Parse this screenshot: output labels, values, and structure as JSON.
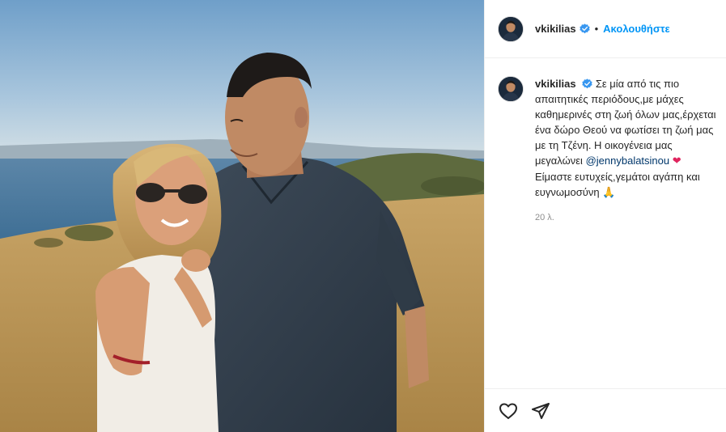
{
  "post": {
    "username": "vkikilias",
    "follow_label": "Ακολουθήστε",
    "separator": "•",
    "caption": {
      "username": "vkikilias",
      "text_part1": "Σε μία από τις πιο απαιτητικές περιόδους,με μάχες καθημερινές στη ζωή όλων μας,έρχεται ένα δώρο Θεού να φωτίσει τη ζωή μας με τη Τζένη. Η οικογένεια μας μεγαλώνει",
      "mention": "@jennybalatsinou",
      "heart_emoji": "❤",
      "text_part2": "Είμαστε ευτυχείς,γεμάτοι αγάπη και ευγνωμοσύνη",
      "pray_emoji": "🙏",
      "time": "20 λ."
    },
    "icons": {
      "verified": "verified-badge-icon",
      "like": "heart-icon",
      "share": "paper-plane-icon"
    },
    "colors": {
      "follow": "#0095f6",
      "verified": "#3897f0",
      "mention": "#00376b",
      "muted": "#8e8e8e"
    }
  }
}
